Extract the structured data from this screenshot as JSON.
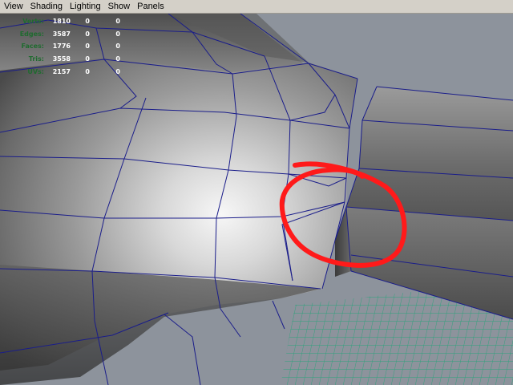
{
  "menu": {
    "items": [
      {
        "label": "View"
      },
      {
        "label": "Shading"
      },
      {
        "label": "Lighting"
      },
      {
        "label": "Show"
      },
      {
        "label": "Panels"
      }
    ]
  },
  "hud": {
    "rows": [
      {
        "label": "Verts:",
        "v1": "1810",
        "v2": "0",
        "v3": "0"
      },
      {
        "label": "Edges:",
        "v1": "3587",
        "v2": "0",
        "v3": "0"
      },
      {
        "label": "Faces:",
        "v1": "1776",
        "v2": "0",
        "v3": "0"
      },
      {
        "label": "Tris:",
        "v1": "3558",
        "v2": "0",
        "v3": "0"
      },
      {
        "label": "UVs:",
        "v1": "2157",
        "v2": "0",
        "v3": "0"
      }
    ]
  },
  "colors": {
    "background": "#8d939c",
    "wireframe": "#1a1d8a",
    "grid": "#2aa37a",
    "annotation": "#ff1a1a",
    "hud_label": "#1f6b2f",
    "hud_value": "#ffffff"
  }
}
